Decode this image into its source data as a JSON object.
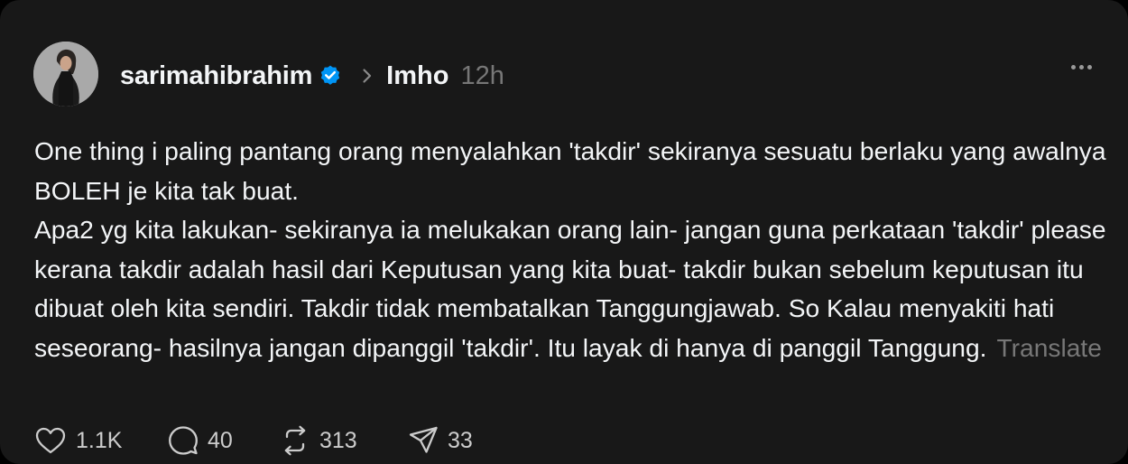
{
  "post": {
    "author": {
      "username": "sarimahibrahim",
      "verified": true,
      "avatar_icon": "profile-photo-avatar"
    },
    "topic": "Imho",
    "time": "12h",
    "more_icon": "more-options-icon",
    "body_paragraphs": [
      "One thing i paling pantang orang menyalahkan 'takdir' sekiranya sesuatu berlaku yang awalnya BOLEH je kita tak buat.",
      "Apa2 yg kita lakukan- sekiranya ia melukakan orang lain- jangan guna perkataan 'takdir' please kerana takdir adalah hasil dari Keputusan yang kita buat- takdir bukan sebelum keputusan itu dibuat oleh kita sendiri. Takdir tidak membatalkan Tanggungjawab. So Kalau menyakiti hati seseorang- hasilnya jangan dipanggil 'takdir'. Itu layak di hanya di panggil Tanggung."
    ],
    "translate_label": "Translate",
    "actions": {
      "likes": "1.1K",
      "replies": "40",
      "reposts": "313",
      "shares": "33"
    }
  },
  "colors": {
    "background": "#181818",
    "text": "#f3f5f7",
    "muted": "#777777",
    "verified_badge": "#0095f6"
  }
}
